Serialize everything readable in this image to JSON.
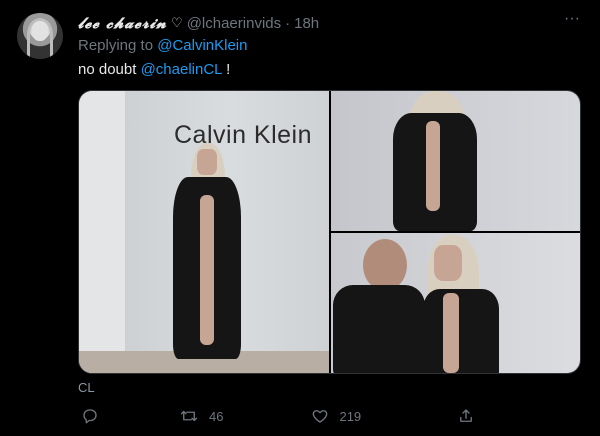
{
  "tweet": {
    "display_name": "𝓵𝓮𝓮 𝓬𝓱𝓪𝓮𝓻𝓲𝓷",
    "handle": "@lchaerinvids",
    "separator": "·",
    "time": "18h",
    "replying_prefix": "Replying to",
    "replying_to": "@CalvinKlein",
    "text_prefix": "no doubt",
    "mention": "@chaelinCL",
    "text_suffix": "!",
    "media_label": "CL",
    "photo_text": "Calvin Klein",
    "retweets": "46",
    "likes": "219"
  },
  "icons": {
    "verified_heart": "heart-outline-icon",
    "more": "more-dots-icon",
    "reply": "reply-icon",
    "retweet": "retweet-icon",
    "like": "like-icon",
    "share": "share-icon"
  },
  "colors": {
    "background": "#000000",
    "link": "#1d9bf0",
    "muted": "#6e767d",
    "text": "#e7e9ea"
  }
}
